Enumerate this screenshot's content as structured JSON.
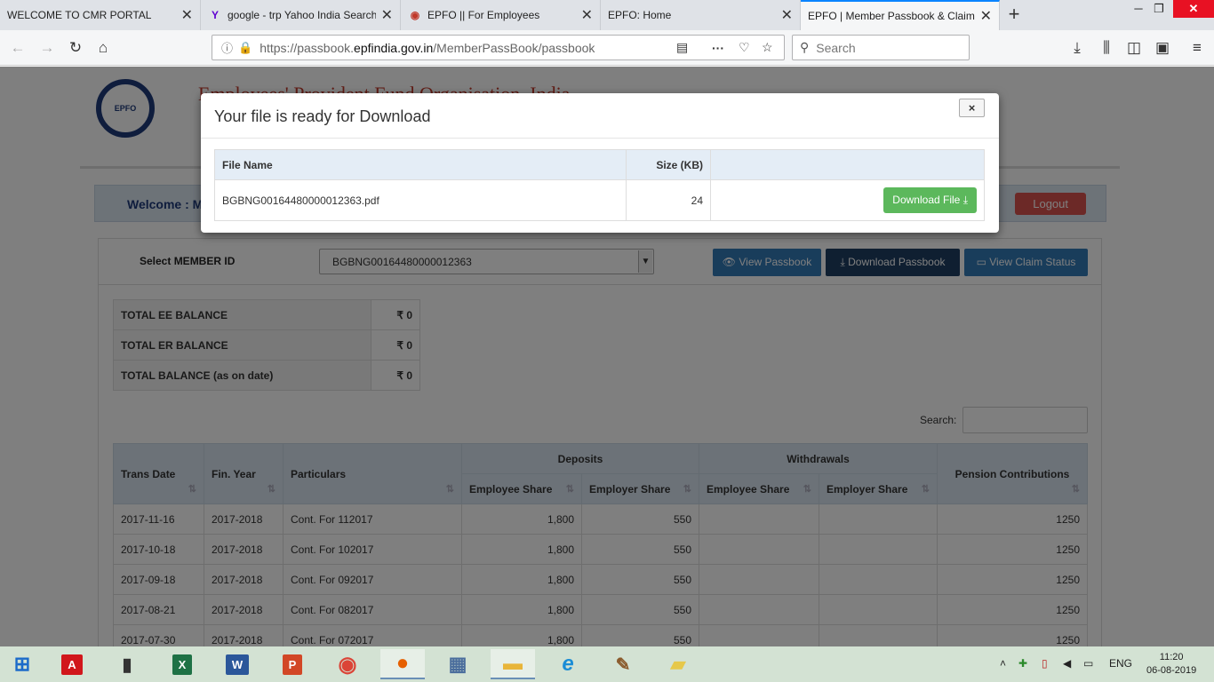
{
  "browser": {
    "tabs": [
      {
        "title": "WELCOME TO CMR PORTAL"
      },
      {
        "title": "google - trp Yahoo India Search"
      },
      {
        "title": "EPFO || For Employees"
      },
      {
        "title": "EPFO: Home"
      },
      {
        "title": "EPFO | Member Passbook & Claim"
      }
    ],
    "url_prefix": "https://passbook.",
    "url_host": "epfindia.gov.in",
    "url_path": "/MemberPassBook/passbook",
    "search_placeholder": "Search"
  },
  "site": {
    "org_name": "Employees' Provident Fund Organisation, India",
    "welcome": "Welcome : M",
    "logout": "Logout"
  },
  "form": {
    "select_label": "Select MEMBER ID",
    "member_id": "BGBNG00164480000012363",
    "view_passbook": "View Passbook",
    "download_passbook": "Download Passbook",
    "view_claim_status": "View Claim Status"
  },
  "balances": [
    {
      "label": "TOTAL EE BALANCE",
      "value": "₹ 0"
    },
    {
      "label": "TOTAL ER BALANCE",
      "value": "₹ 0"
    },
    {
      "label": "TOTAL BALANCE (as on date)",
      "value": "₹ 0"
    }
  ],
  "table": {
    "search_label": "Search:",
    "headers": {
      "trans_date": "Trans Date",
      "fin_year": "Fin. Year",
      "particulars": "Particulars",
      "deposits": "Deposits",
      "withdrawals": "Withdrawals",
      "pension": "Pension Contributions",
      "employee_share": "Employee Share",
      "employer_share": "Employer Share"
    },
    "rows": [
      {
        "date": "2017-11-16",
        "year": "2017-2018",
        "particulars": "Cont. For 112017",
        "dep_ee": "1,800",
        "dep_er": "550",
        "wd_ee": "",
        "wd_er": "",
        "pension": "1250"
      },
      {
        "date": "2017-10-18",
        "year": "2017-2018",
        "particulars": "Cont. For 102017",
        "dep_ee": "1,800",
        "dep_er": "550",
        "wd_ee": "",
        "wd_er": "",
        "pension": "1250"
      },
      {
        "date": "2017-09-18",
        "year": "2017-2018",
        "particulars": "Cont. For 092017",
        "dep_ee": "1,800",
        "dep_er": "550",
        "wd_ee": "",
        "wd_er": "",
        "pension": "1250"
      },
      {
        "date": "2017-08-21",
        "year": "2017-2018",
        "particulars": "Cont. For 082017",
        "dep_ee": "1,800",
        "dep_er": "550",
        "wd_ee": "",
        "wd_er": "",
        "pension": "1250"
      },
      {
        "date": "2017-07-30",
        "year": "2017-2018",
        "particulars": "Cont. For 072017",
        "dep_ee": "1,800",
        "dep_er": "550",
        "wd_ee": "",
        "wd_er": "",
        "pension": "1250"
      }
    ]
  },
  "modal": {
    "title": "Your file is ready for Download",
    "close": "×",
    "col_file_name": "File Name",
    "col_size": "Size (KB)",
    "file_name": "BGBNG00164480000012363.pdf",
    "size": "24",
    "download": "Download File"
  },
  "taskbar": {
    "lang": "ENG",
    "time": "11:20",
    "date": "06-08-2019"
  }
}
